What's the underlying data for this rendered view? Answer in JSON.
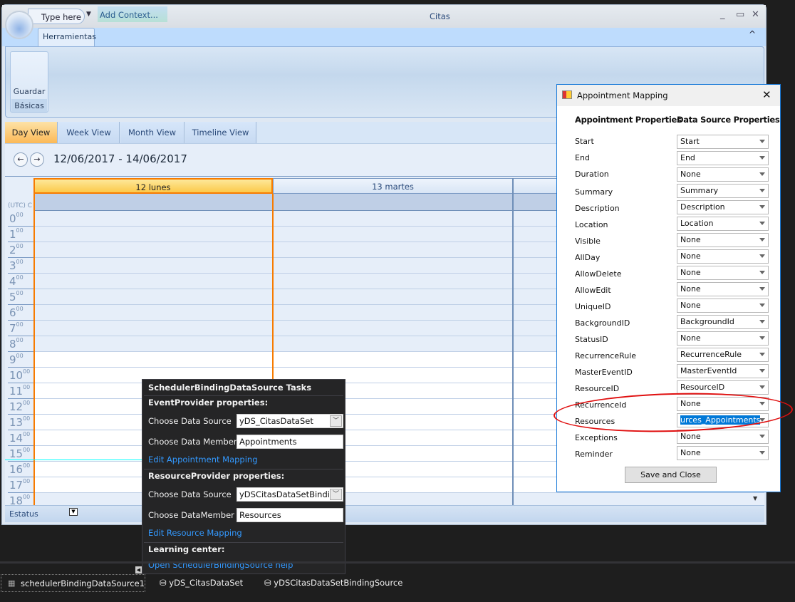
{
  "window": {
    "title": "Citas",
    "quick_access": "Type here",
    "add_context": "Add Context...",
    "min": "_",
    "max": "▭",
    "close": "✕",
    "collapse": "^"
  },
  "ribbon": {
    "tab": "Herramientas",
    "button": "Guardar",
    "group": "Básicas"
  },
  "views": [
    "Day View",
    "Week View",
    "Month View",
    "Timeline View"
  ],
  "active_view": "Day View",
  "date_range": "12/06/2017 - 14/06/2017",
  "nav": {
    "prev": "←",
    "next": "→"
  },
  "timezone": "(UTC) C",
  "days": [
    "12 lunes",
    "13 martes"
  ],
  "hours": [
    "0",
    "1",
    "2",
    "3",
    "4",
    "5",
    "6",
    "7",
    "8",
    "9",
    "10",
    "11",
    "12",
    "13",
    "14",
    "15",
    "16",
    "17",
    "18"
  ],
  "minutes": "00",
  "statusbar": {
    "label": "Estatus"
  },
  "dialog": {
    "title": "Appointment Mapping",
    "col1": "Appointment Properties",
    "col2": "Data Source Properties",
    "rows": [
      {
        "prop": "Start",
        "value": "Start"
      },
      {
        "prop": "End",
        "value": "End"
      },
      {
        "prop": "Duration",
        "value": "None"
      },
      {
        "prop": "Summary",
        "value": "Summary"
      },
      {
        "prop": "Description",
        "value": "Description"
      },
      {
        "prop": "Location",
        "value": "Location"
      },
      {
        "prop": "Visible",
        "value": "None"
      },
      {
        "prop": "AllDay",
        "value": "None"
      },
      {
        "prop": "AllowDelete",
        "value": "None"
      },
      {
        "prop": "AllowEdit",
        "value": "None"
      },
      {
        "prop": "UniqueID",
        "value": "None"
      },
      {
        "prop": "BackgroundID",
        "value": "BackgroundId"
      },
      {
        "prop": "StatusID",
        "value": "None"
      },
      {
        "prop": "RecurrenceRule",
        "value": "RecurrenceRule"
      },
      {
        "prop": "MasterEventID",
        "value": "MasterEventId"
      },
      {
        "prop": "ResourceID",
        "value": "ResourceID"
      },
      {
        "prop": "RecurrenceId",
        "value": "None"
      },
      {
        "prop": "Resources",
        "value": "urces_Appointments"
      },
      {
        "prop": "Exceptions",
        "value": "None"
      },
      {
        "prop": "Reminder",
        "value": "None"
      }
    ],
    "save": "Save and Close",
    "annotation_color": "#e01010"
  },
  "tasks": {
    "title": "SchedulerBindingDataSource Tasks",
    "event_header": "EventProvider properties:",
    "ev_source_label": "Choose Data Source",
    "ev_source": "yDS_CitasDataSet",
    "ev_member_label": "Choose Data Member",
    "ev_member": "Appointments",
    "ev_link": "Edit Appointment Mapping",
    "res_header": "ResourceProvider properties:",
    "res_source_label": "Choose Data Source",
    "res_source": "yDSCitasDataSetBindin",
    "res_member_label": "Choose DataMember",
    "res_member": "Resources",
    "res_link": "Edit Resource Mapping",
    "learn_header": "Learning center:",
    "help_link": "Open SchedulerBindingSource help"
  },
  "tray": [
    "schedulerBindingDataSource1",
    "yDS_CitasDataSet",
    "yDSCitasDataSetBindingSource"
  ]
}
